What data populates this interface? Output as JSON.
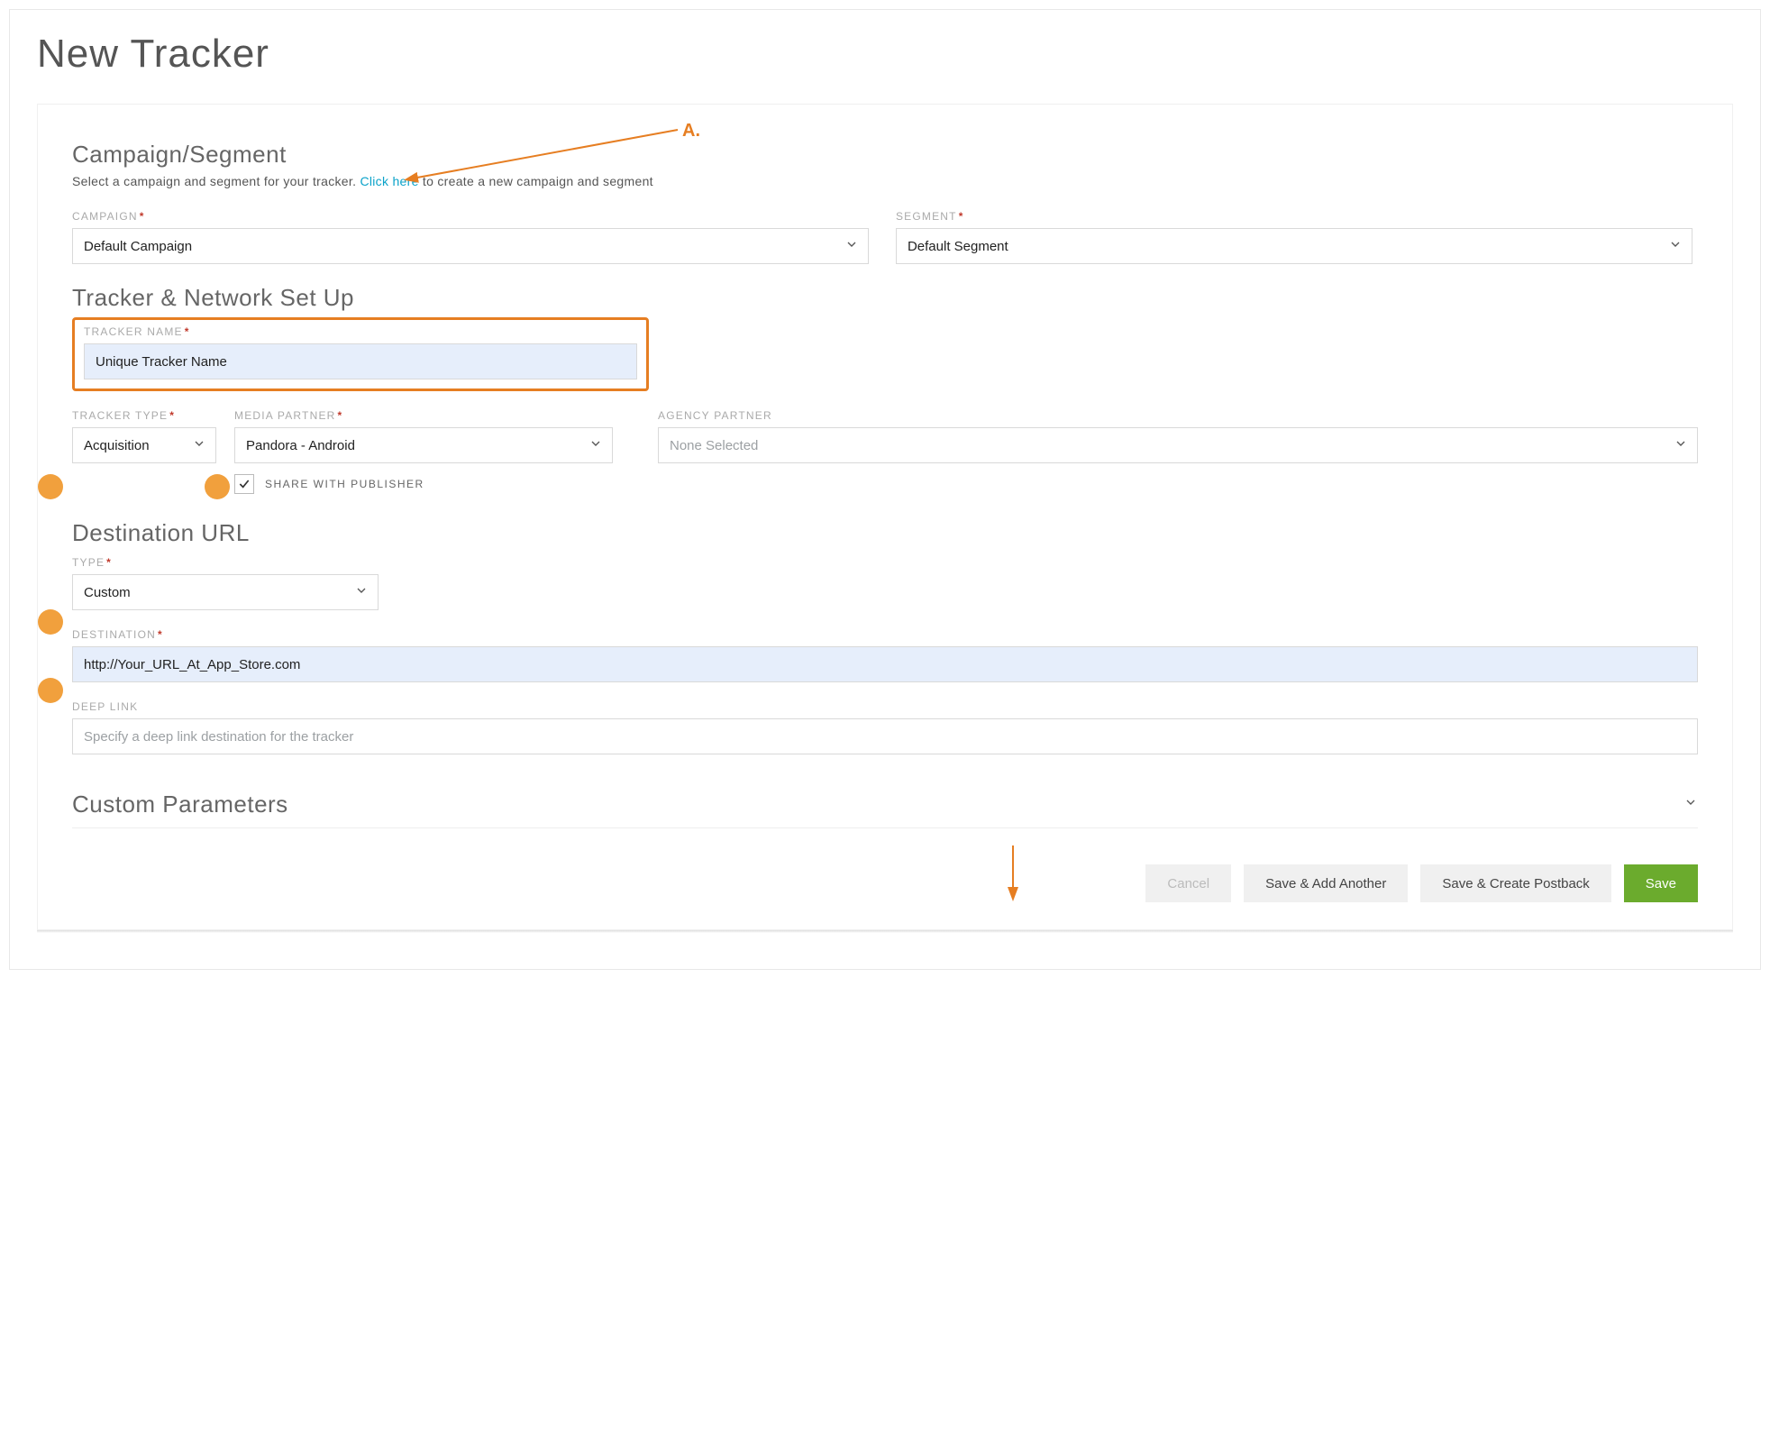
{
  "page": {
    "title": "New Tracker"
  },
  "annotation": {
    "labelA": "A."
  },
  "campaignSegment": {
    "title": "Campaign/Segment",
    "desc_prefix": "Select a campaign and segment for your tracker. ",
    "link_text": "Click here",
    "desc_suffix": " to create a new campaign and segment",
    "campaign_label": "CAMPAIGN",
    "campaign_value": "Default Campaign",
    "segment_label": "SEGMENT",
    "segment_value": "Default Segment"
  },
  "trackerNetwork": {
    "title": "Tracker & Network Set Up",
    "tracker_name_label": "TRACKER NAME",
    "tracker_name_value": "Unique Tracker Name",
    "tracker_type_label": "TRACKER TYPE",
    "tracker_type_value": "Acquisition",
    "media_partner_label": "MEDIA PARTNER",
    "media_partner_value": "Pandora - Android",
    "agency_partner_label": "AGENCY PARTNER",
    "agency_partner_value": "None Selected",
    "share_publisher_label": "SHARE WITH PUBLISHER",
    "share_publisher_checked": true
  },
  "destination": {
    "title": "Destination URL",
    "type_label": "TYPE",
    "type_value": "Custom",
    "destination_label": "DESTINATION",
    "destination_value": "http://Your_URL_At_App_Store.com",
    "deeplink_label": "DEEP LINK",
    "deeplink_placeholder": "Specify a deep link destination for the tracker"
  },
  "customParams": {
    "title": "Custom Parameters"
  },
  "buttons": {
    "cancel": "Cancel",
    "save_another": "Save & Add Another",
    "save_postback": "Save & Create Postback",
    "save": "Save"
  },
  "colors": {
    "accent_orange": "#e67e22",
    "primary_green": "#6bab2d",
    "link": "#0aa2c9"
  }
}
